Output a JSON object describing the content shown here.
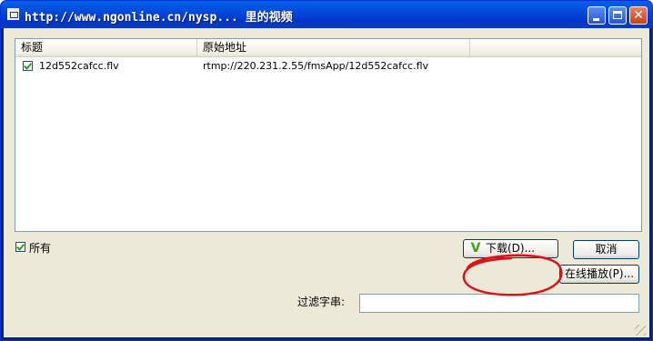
{
  "window": {
    "title": "http://www.ngonline.cn/nysp... 里的视频"
  },
  "list": {
    "columns": [
      "标题",
      "原始地址",
      ""
    ],
    "rows": [
      {
        "checked": true,
        "title": "12d552cafcc.flv",
        "url": "rtmp://220.231.2.55/fmsApp/12d552cafcc.flv"
      }
    ]
  },
  "select_all": {
    "label": "所有",
    "checked": true
  },
  "buttons": {
    "download": "下载(D)...",
    "cancel": "取消",
    "play_online": "在线播放(P)..."
  },
  "filter": {
    "label": "过滤字串:",
    "value": ""
  },
  "colors": {
    "titlebar": "#0346d8",
    "client": "#ece9d8",
    "annotation": "#e0101a",
    "download_icon": "#3aa314"
  },
  "icons": {
    "download": "green-check-arrow-icon"
  }
}
